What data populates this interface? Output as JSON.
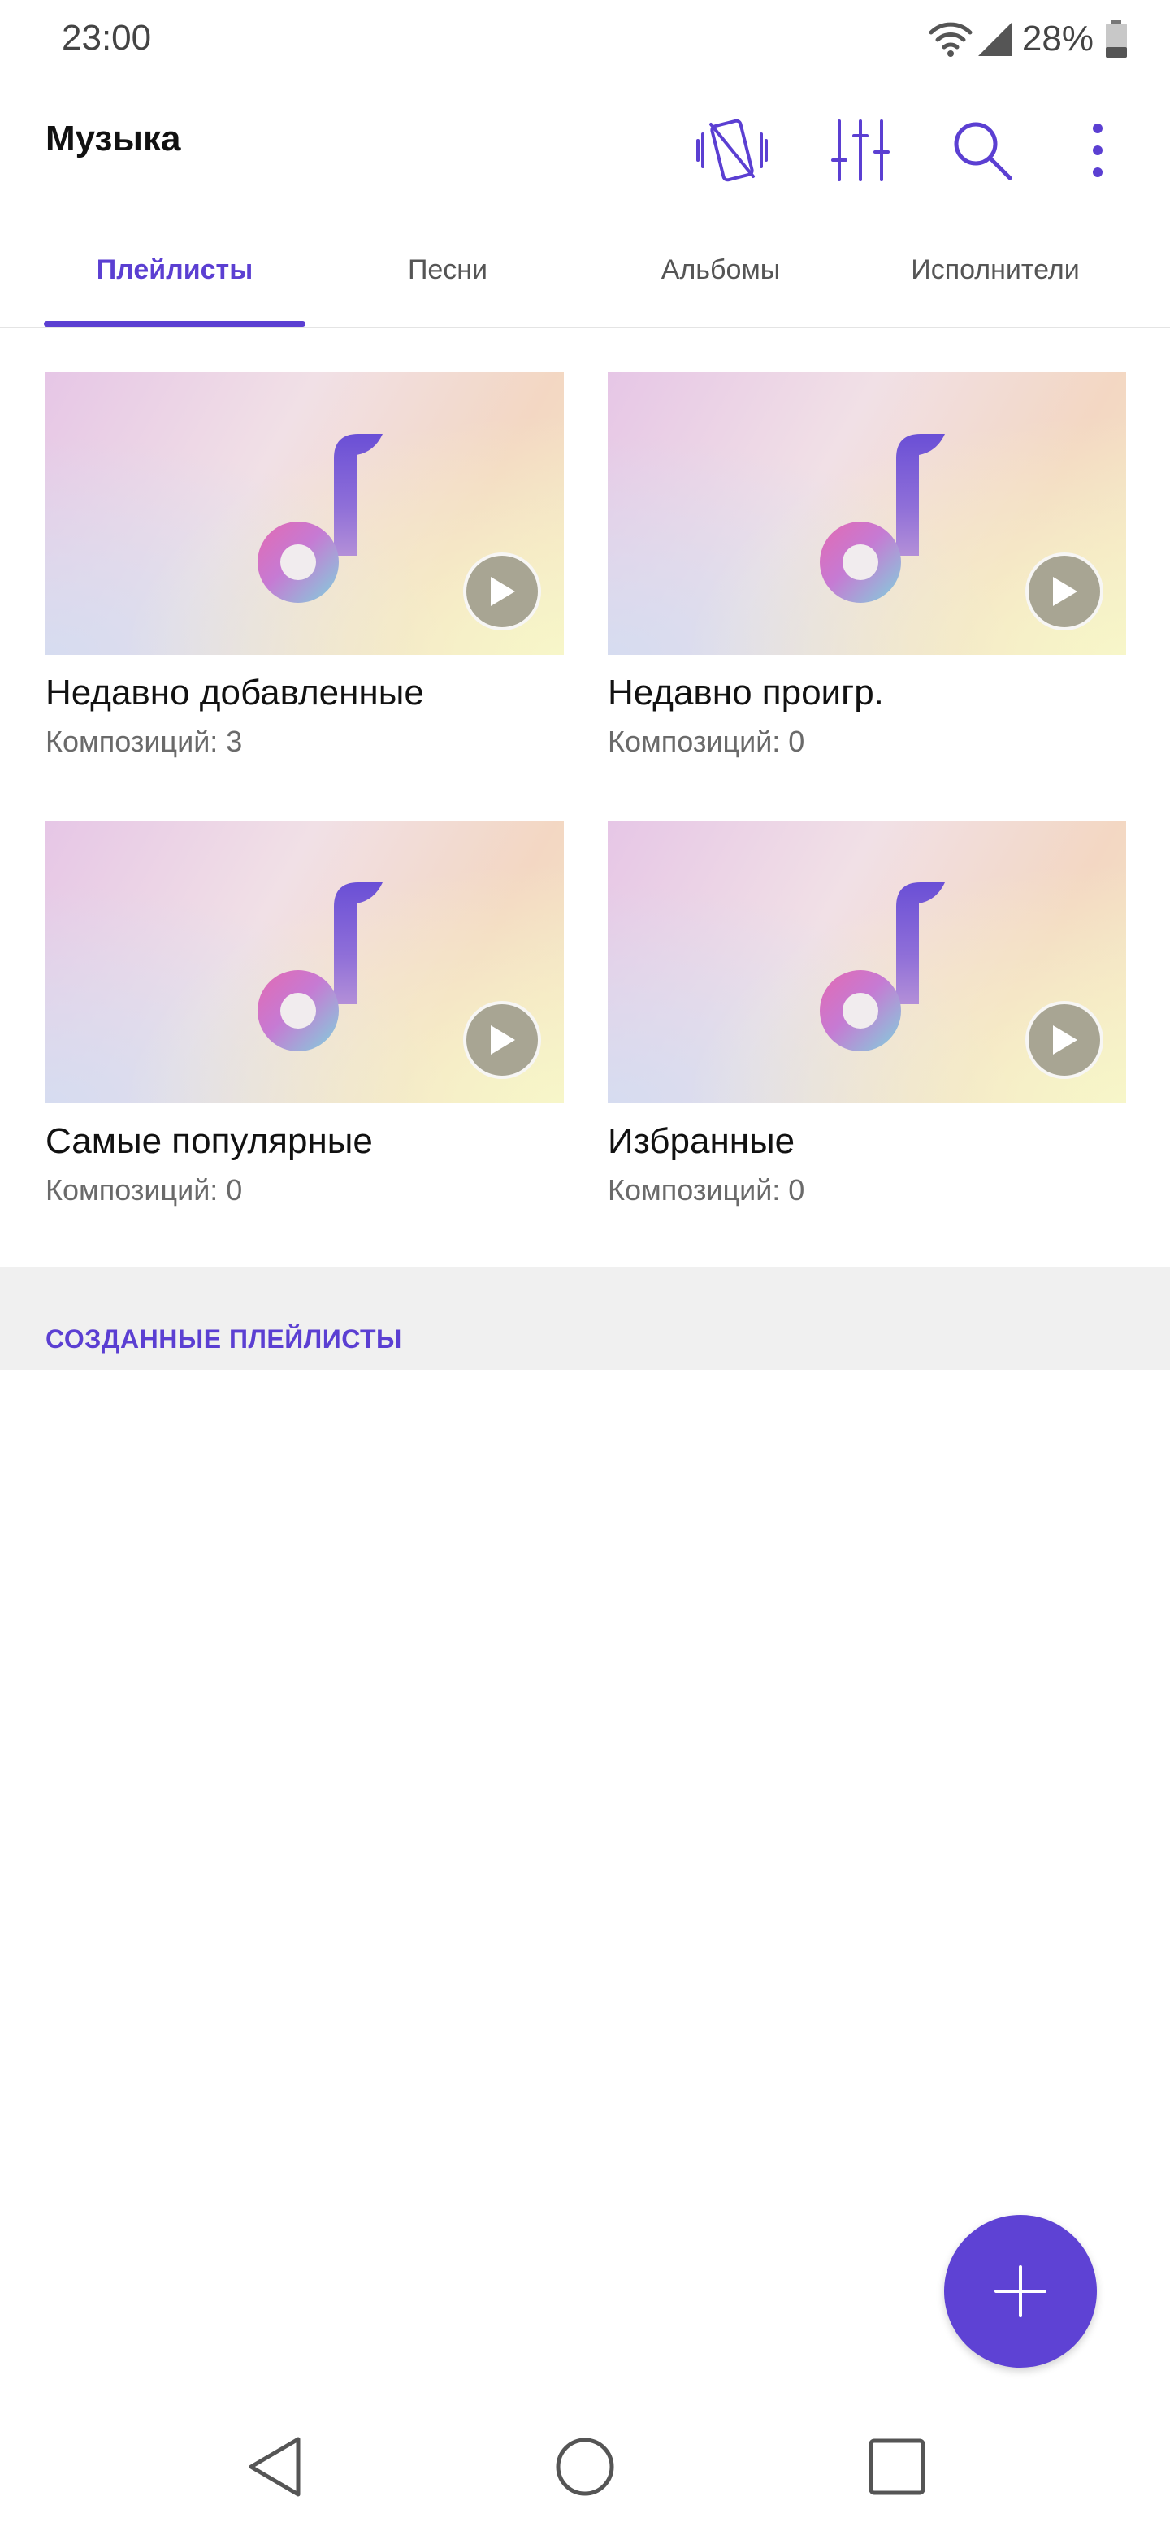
{
  "status_bar": {
    "time": "23:00",
    "battery": "28%",
    "icons": [
      "wifi-icon",
      "signal-icon",
      "battery-icon"
    ]
  },
  "app_bar": {
    "title": "Музыка",
    "actions": [
      "auto-rotate-off-icon",
      "equalizer-icon",
      "search-icon",
      "more-vert-icon"
    ]
  },
  "tabs": [
    {
      "label": "Плейлисты",
      "active": true
    },
    {
      "label": "Песни",
      "active": false
    },
    {
      "label": "Альбомы",
      "active": false
    },
    {
      "label": "Исполнители",
      "active": false
    }
  ],
  "playlists": [
    {
      "title": "Недавно добавленные",
      "subtitle": "Композиций: 3"
    },
    {
      "title": "Недавно проигр.",
      "subtitle": "Композиций: 0"
    },
    {
      "title": "Самые популярные",
      "subtitle": "Композиций: 0"
    },
    {
      "title": "Избранные",
      "subtitle": "Композиций: 0"
    }
  ],
  "section": {
    "title": "СОЗДАННЫЕ ПЛЕЙЛИСТЫ"
  },
  "fab": {
    "icon": "add-icon"
  },
  "nav_bar": {
    "buttons": [
      "back-icon",
      "home-icon",
      "recents-icon"
    ]
  },
  "colors": {
    "accent": "#5b3fd2",
    "fab": "#5e42d4",
    "section_bg": "#f0f0f0"
  }
}
